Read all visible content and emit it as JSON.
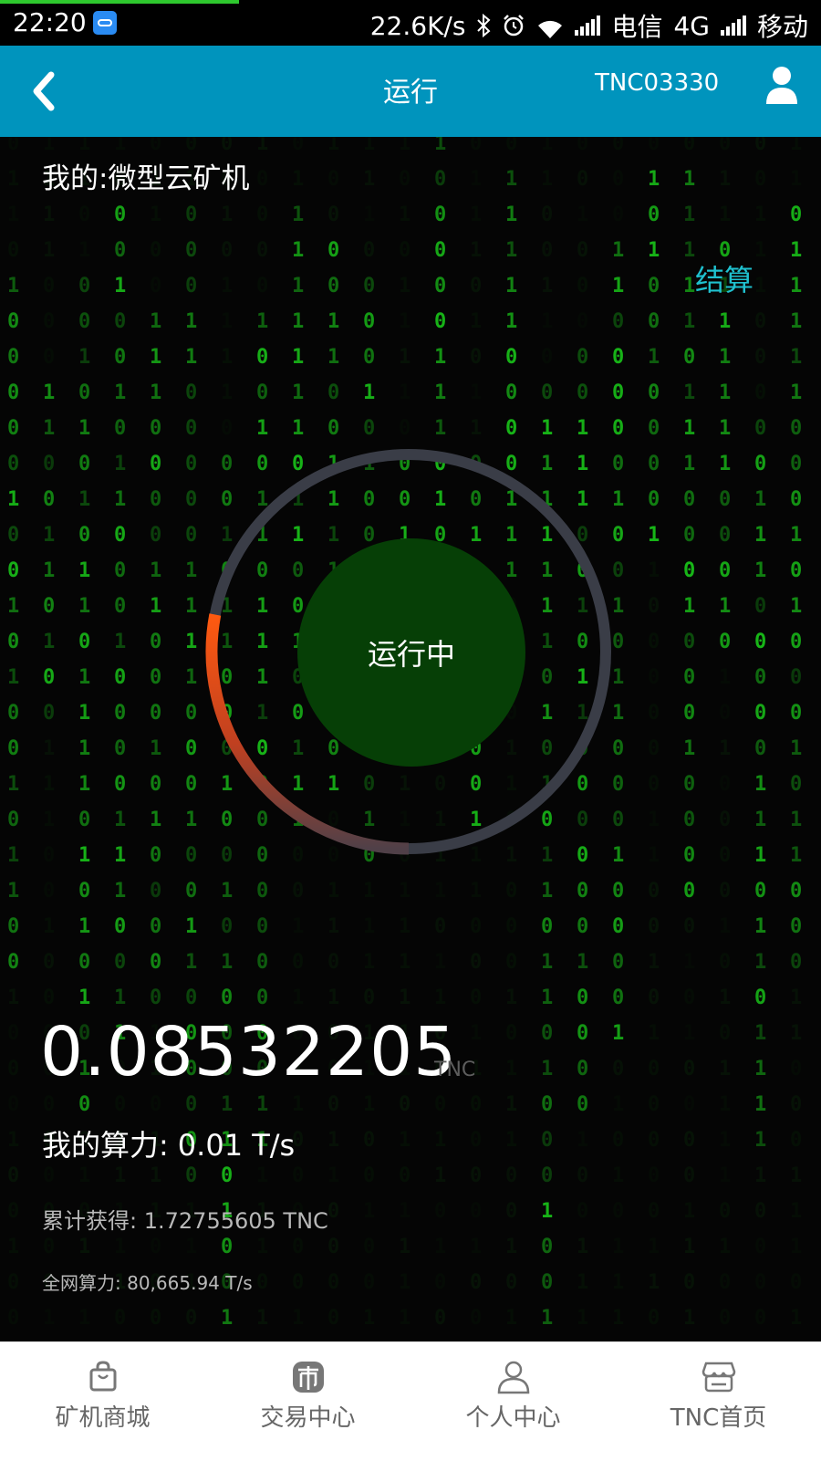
{
  "status_bar": {
    "time": "22:20",
    "net_speed": "22.6K/s",
    "carrier1": "电信",
    "network_type": "4G",
    "carrier2": "移动",
    "icons": [
      "cloud-icon",
      "bluetooth-icon",
      "alarm-icon",
      "wifi-icon",
      "signal-icon",
      "signal-icon"
    ]
  },
  "header": {
    "title": "运行",
    "account": "TNC03330",
    "back_icon": "chevron-left-icon",
    "user_icon": "user-icon"
  },
  "main": {
    "title": "我的:微型云矿机",
    "settle_label": "结算",
    "status_text": "运行中",
    "progress": 0.28,
    "colors": {
      "accent": "#1fc1cf",
      "status_bg": "#063f06",
      "progress": "#f26a1b",
      "track": "#3a3d47",
      "header": "#0094bd"
    },
    "balance": "0.08532205",
    "balance_unit": "TNC",
    "hashrate_label": "我的算力:",
    "hashrate_value": "0.01 T/s",
    "cumulative_label": "累计获得:",
    "cumulative_value": "1.72755605 TNC",
    "network_label": "全网算力:",
    "network_value": "80,665.94 T/s"
  },
  "bottom_nav": [
    {
      "label": "矿机商城",
      "icon": "shopping-bag-icon"
    },
    {
      "label": "交易中心",
      "icon": "market-icon"
    },
    {
      "label": "个人中心",
      "icon": "person-icon"
    },
    {
      "label": "TNC首页",
      "icon": "store-icon"
    }
  ]
}
